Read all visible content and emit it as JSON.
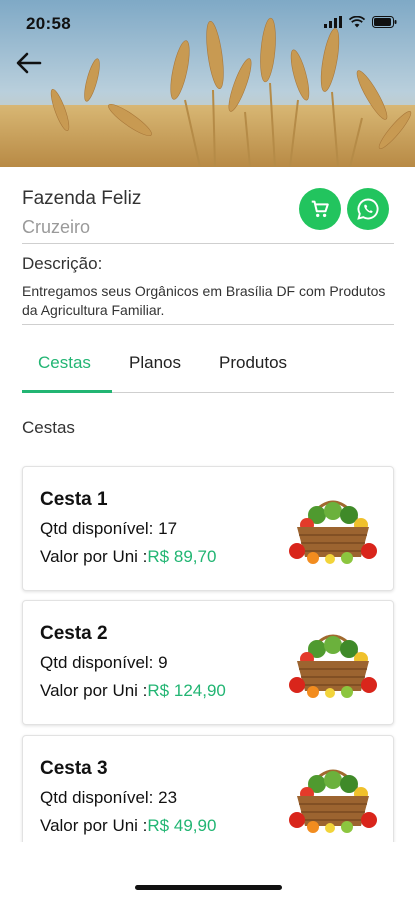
{
  "status_bar": {
    "time": "20:58"
  },
  "farm": {
    "name": "Fazenda Feliz",
    "city": "Cruzeiro"
  },
  "description": {
    "title": "Descrição:",
    "text": "Entregamos seus Orgânicos em Brasília DF com Produtos da Agricultura Familiar."
  },
  "tabs": [
    {
      "label": "Cestas",
      "active": true
    },
    {
      "label": "Planos",
      "active": false
    },
    {
      "label": "Produtos",
      "active": false
    }
  ],
  "section_title": "Cestas",
  "baskets": [
    {
      "name": "Cesta 1",
      "qty_label": "Qtd disponível: 17",
      "price_label": "Valor por Uni :",
      "price": "R$ 89,70"
    },
    {
      "name": "Cesta 2",
      "qty_label": "Qtd disponível: 9",
      "price_label": "Valor por Uni :",
      "price": "R$ 124,90"
    },
    {
      "name": "Cesta 3",
      "qty_label": "Qtd disponível: 23",
      "price_label": "Valor por Uni :",
      "price": "R$ 49,90"
    }
  ],
  "colors": {
    "accent": "#22b573",
    "button_green": "#22c45e"
  },
  "icons": [
    "back-arrow-icon",
    "cart-icon",
    "whatsapp-icon",
    "signal-icon",
    "wifi-icon",
    "battery-icon"
  ]
}
